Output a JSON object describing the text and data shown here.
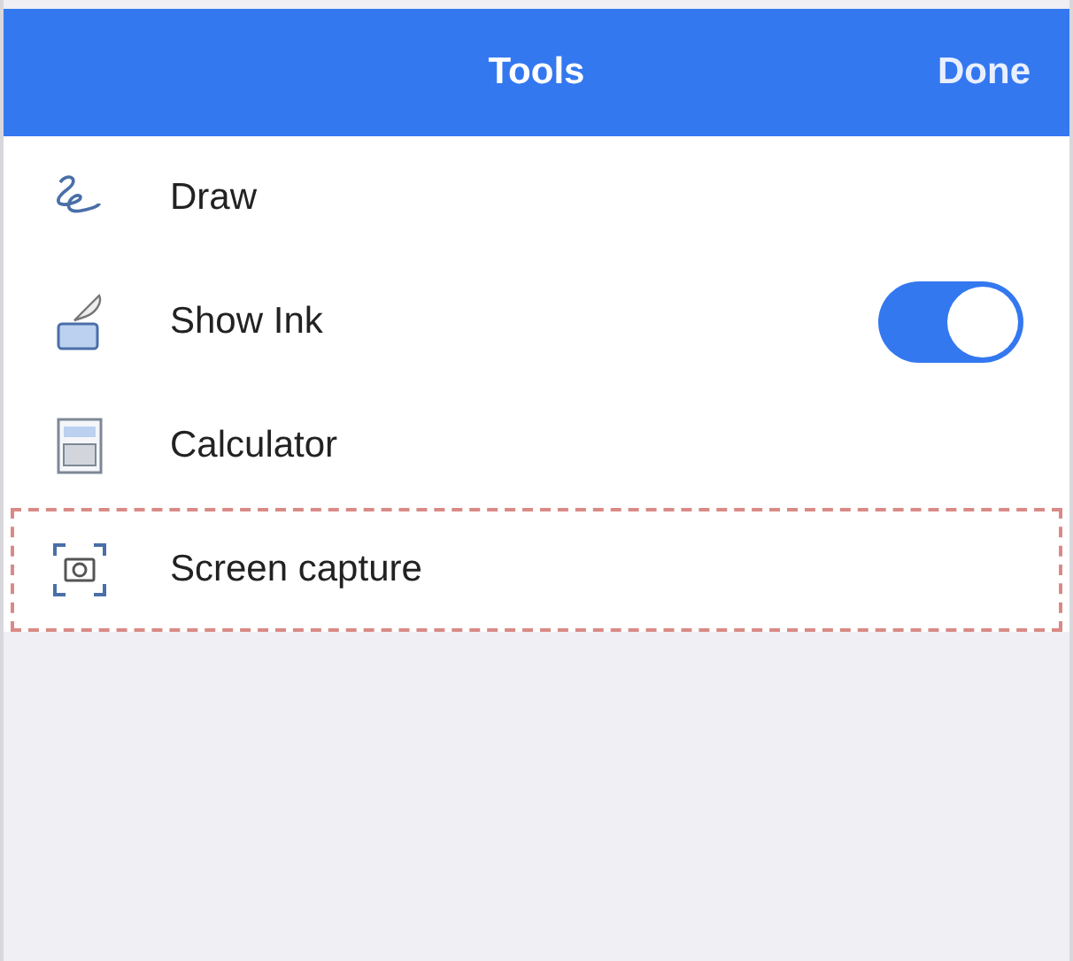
{
  "header": {
    "title": "Tools",
    "action": "Done"
  },
  "items": [
    {
      "label": "Draw",
      "kind": "plain",
      "highlighted": false
    },
    {
      "label": "Show Ink",
      "kind": "toggle",
      "on": true,
      "highlighted": false
    },
    {
      "label": "Calculator",
      "kind": "plain",
      "highlighted": false
    },
    {
      "label": "Screen capture",
      "kind": "plain",
      "highlighted": true
    }
  ]
}
